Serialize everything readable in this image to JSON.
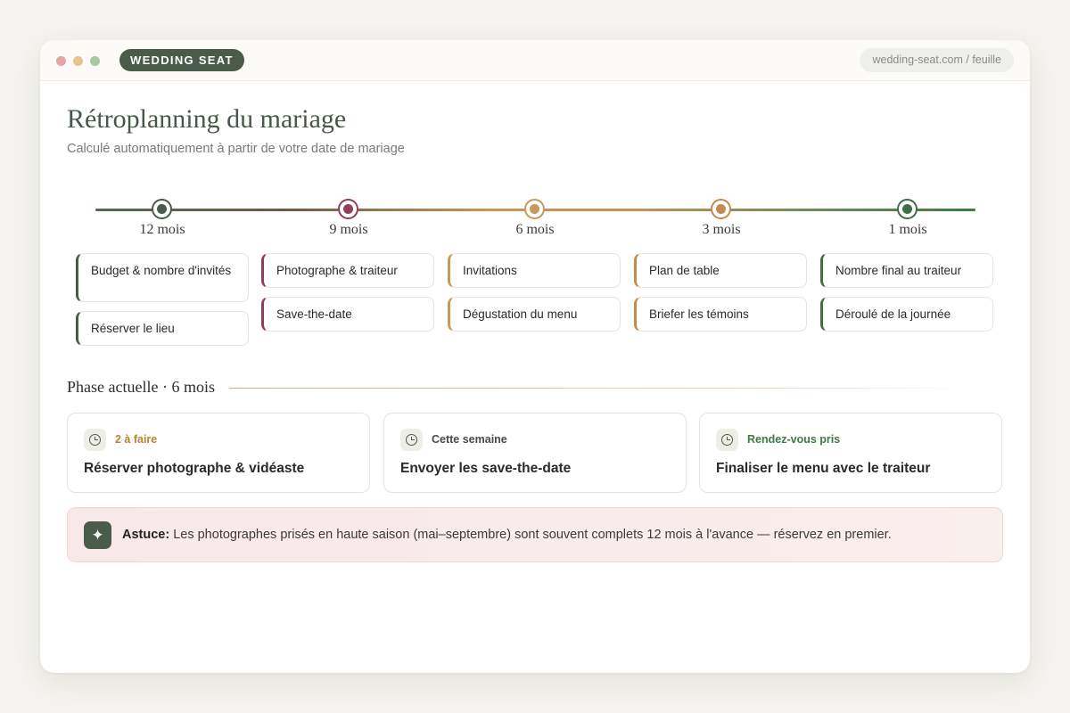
{
  "window": {
    "brand": "WEDDING SEAT",
    "url": "wedding-seat.com / feuille"
  },
  "page": {
    "title": "Rétroplanning du mariage",
    "subtitle": "Calculé automatiquement à partir de votre date de mariage"
  },
  "timeline": {
    "milestones": [
      {
        "label": "12 mois",
        "color": "#4a5b49",
        "tasks": [
          "Budget & nombre d'invités",
          "Réserver le lieu"
        ]
      },
      {
        "label": "9 mois",
        "color": "#8e3f5b",
        "tasks": [
          "Photographe & traiteur",
          "Save-the-date"
        ]
      },
      {
        "label": "6 mois",
        "color": "#c8995a",
        "tasks": [
          "Invitations",
          "Dégustation du menu"
        ]
      },
      {
        "label": "3 mois",
        "color": "#c48a4e",
        "tasks": [
          "Plan de table",
          "Briefer les témoins"
        ]
      },
      {
        "label": "1 mois",
        "color": "#3f6f44",
        "tasks": [
          "Nombre final au traiteur",
          "Déroulé de la journée"
        ]
      }
    ]
  },
  "phase": {
    "title": "Phase actuelle · 6 mois",
    "cards": [
      {
        "badge": "2 à faire",
        "badge_color": "#b8822f",
        "icon": "clock-icon",
        "task": "Réserver photographe & vidéaste"
      },
      {
        "badge": "Cette semaine",
        "badge_color": "#4a4a46",
        "icon": "clock-icon",
        "task": "Envoyer les save-the-date"
      },
      {
        "badge": "Rendez-vous pris",
        "badge_color": "#3f7a44",
        "icon": "clock-icon",
        "task": "Finaliser le menu avec le traiteur"
      }
    ]
  },
  "tip": {
    "icon": "sparkle-icon",
    "label": "Astuce:",
    "text": " Les photographes prisés en haute saison (mai–septembre) sont souvent complets 12 mois à l'avance — réservez en premier."
  }
}
